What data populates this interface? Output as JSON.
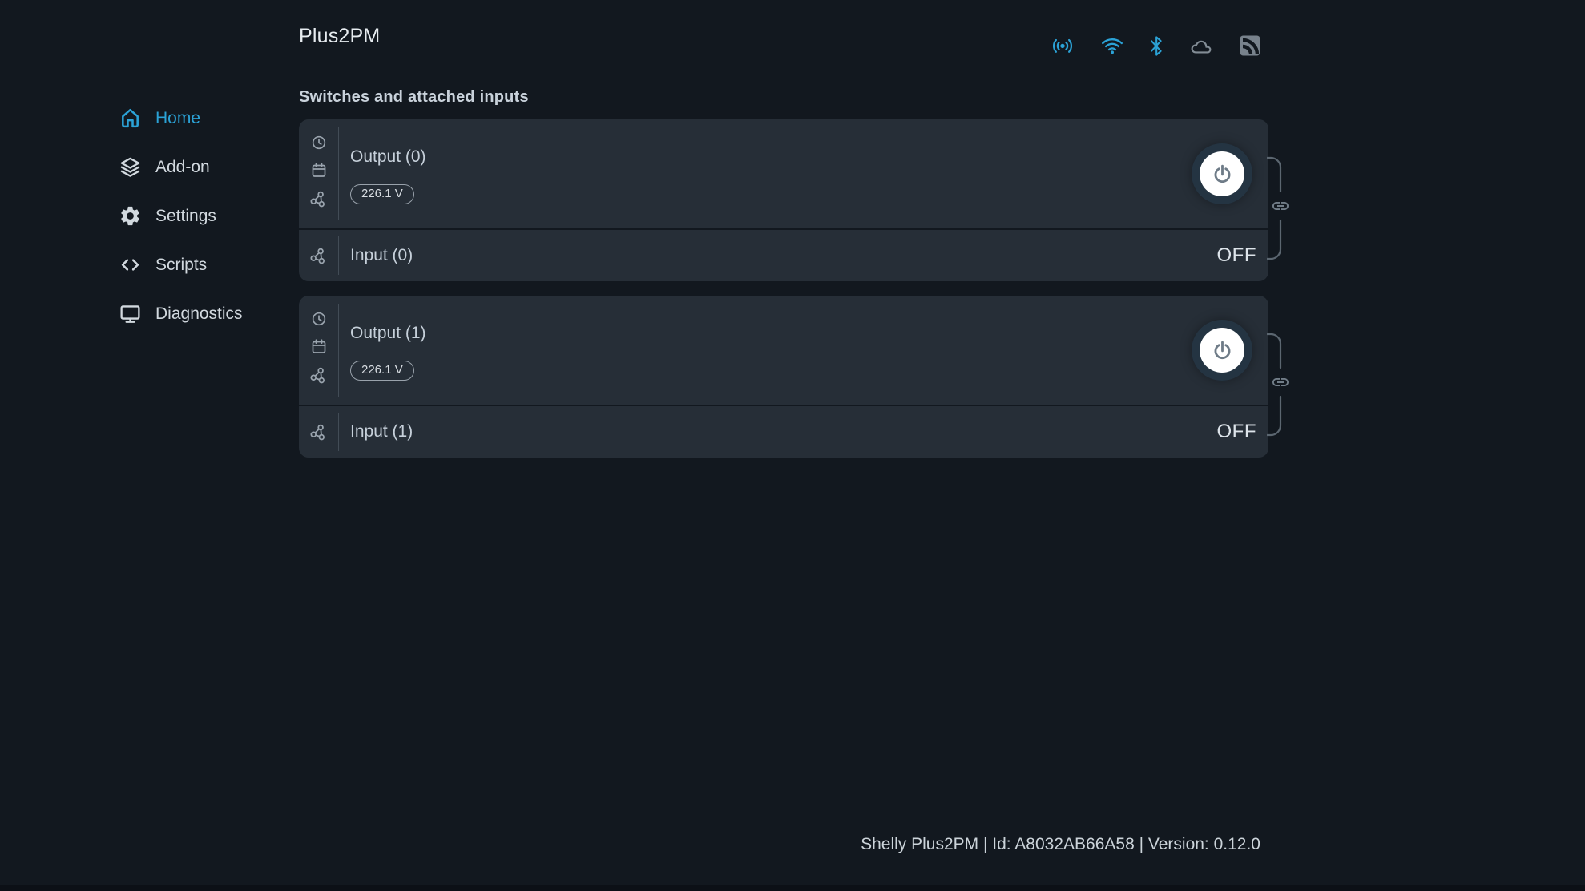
{
  "header": {
    "title": "Plus2PM",
    "status_icons": [
      {
        "name": "ap-broadcast-icon",
        "state": "on"
      },
      {
        "name": "wifi-icon",
        "state": "on"
      },
      {
        "name": "bluetooth-icon",
        "state": "on"
      },
      {
        "name": "cloud-icon",
        "state": "off"
      },
      {
        "name": "debug-log-icon",
        "state": "off"
      }
    ]
  },
  "sidebar": {
    "items": [
      {
        "label": "Home",
        "icon": "home-icon",
        "active": true
      },
      {
        "label": "Add-on",
        "icon": "layers-icon",
        "active": false
      },
      {
        "label": "Settings",
        "icon": "gear-icon",
        "active": false
      },
      {
        "label": "Scripts",
        "icon": "code-icon",
        "active": false
      },
      {
        "label": "Diagnostics",
        "icon": "monitor-icon",
        "active": false
      }
    ]
  },
  "main": {
    "heading": "Switches and attached inputs",
    "cards": [
      {
        "output": {
          "label": "Output (0)",
          "voltage_badge": "226.1 V",
          "rail_icons": [
            "clock-icon",
            "calendar-icon",
            "webhook-icon"
          ]
        },
        "input": {
          "label": "Input (0)",
          "state": "OFF",
          "rail_icons": [
            "webhook-icon"
          ]
        },
        "linked": true
      },
      {
        "output": {
          "label": "Output (1)",
          "voltage_badge": "226.1 V",
          "rail_icons": [
            "clock-icon",
            "calendar-icon",
            "webhook-icon"
          ]
        },
        "input": {
          "label": "Input (1)",
          "state": "OFF",
          "rail_icons": [
            "webhook-icon"
          ]
        },
        "linked": true
      }
    ]
  },
  "footer": {
    "text": "Shelly Plus2PM | Id: A8032AB66A58 | Version: 0.12.0"
  },
  "colors": {
    "accent_blue": "#2ba2d6",
    "page_bg": "#12181f",
    "card_bg": "#262e37",
    "icon_gray": "#9aa4ae",
    "status_gray": "#828c95"
  }
}
